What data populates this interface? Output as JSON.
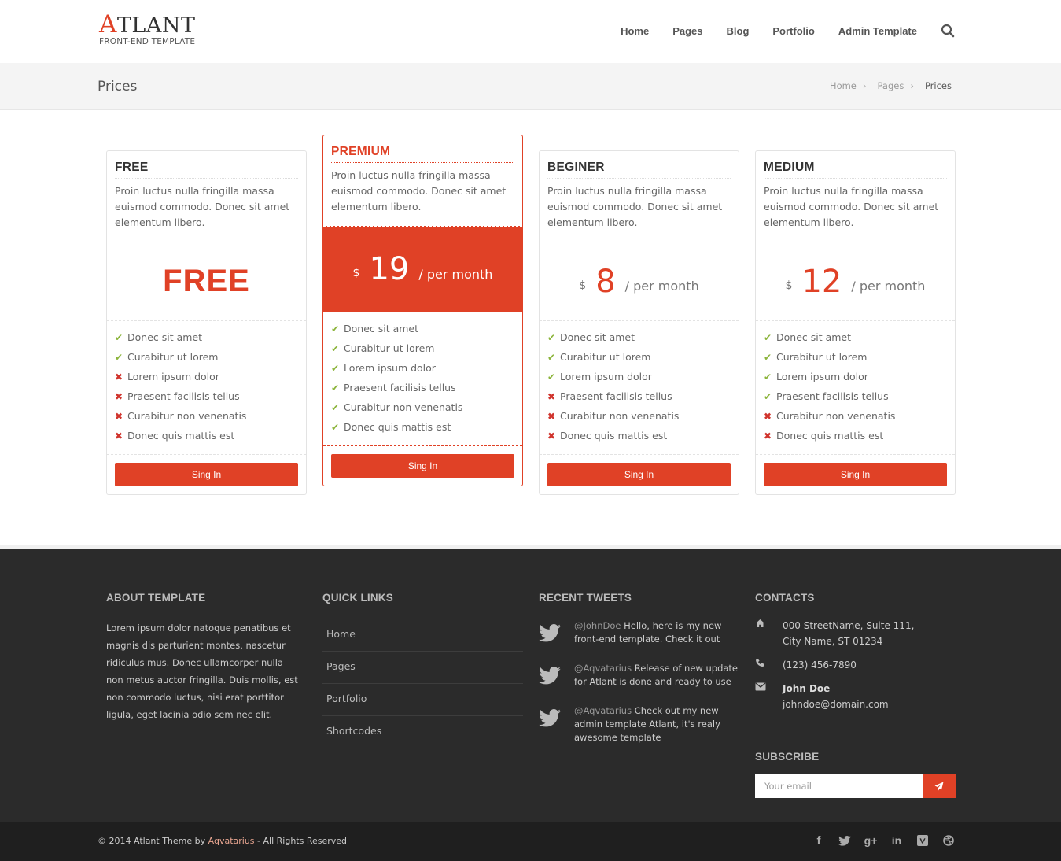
{
  "logo": {
    "first_letter": "A",
    "rest": "TLANT",
    "subtitle": "FRONT-END TEMPLATE"
  },
  "nav": {
    "items": [
      "Home",
      "Pages",
      "Blog",
      "Portfolio",
      "Admin Template"
    ],
    "search_icon": "search-icon"
  },
  "page": {
    "title": "Prices"
  },
  "breadcrumb": {
    "items": [
      "Home",
      "Pages",
      "Prices"
    ]
  },
  "colors": {
    "accent": "#e04126",
    "check": "#8bb43a",
    "cross": "#d0332c",
    "footer_bg": "#2b2b2b",
    "bottom_bg": "#1f1f1f"
  },
  "plans": [
    {
      "name": "FREE",
      "description": "Proin luctus nulla fringilla massa euismod commodo. Donec sit amet elementum libero.",
      "price_label": "FREE",
      "features": [
        {
          "text": "Donec sit amet",
          "included": true
        },
        {
          "text": "Curabitur ut lorem",
          "included": true
        },
        {
          "text": "Lorem ipsum dolor",
          "included": false
        },
        {
          "text": "Praesent facilisis tellus",
          "included": false
        },
        {
          "text": "Curabitur non venenatis",
          "included": false
        },
        {
          "text": "Donec quis mattis est",
          "included": false
        }
      ],
      "button": "Sing In"
    },
    {
      "name": "PREMIUM",
      "description": "Proin luctus nulla fringilla massa euismod commodo. Donec sit amet elementum libero.",
      "currency": "$",
      "amount": "19",
      "period": "/ per month",
      "features": [
        {
          "text": "Donec sit amet",
          "included": true
        },
        {
          "text": "Curabitur ut lorem",
          "included": true
        },
        {
          "text": "Lorem ipsum dolor",
          "included": true
        },
        {
          "text": "Praesent facilisis tellus",
          "included": true
        },
        {
          "text": "Curabitur non venenatis",
          "included": true
        },
        {
          "text": "Donec quis mattis est",
          "included": true
        }
      ],
      "button": "Sing In"
    },
    {
      "name": "BEGINER",
      "description": "Proin luctus nulla fringilla massa euismod commodo. Donec sit amet elementum libero.",
      "currency": "$",
      "amount": "8",
      "period": "/ per month",
      "features": [
        {
          "text": "Donec sit amet",
          "included": true
        },
        {
          "text": "Curabitur ut lorem",
          "included": true
        },
        {
          "text": "Lorem ipsum dolor",
          "included": true
        },
        {
          "text": "Praesent facilisis tellus",
          "included": false
        },
        {
          "text": "Curabitur non venenatis",
          "included": false
        },
        {
          "text": "Donec quis mattis est",
          "included": false
        }
      ],
      "button": "Sing In"
    },
    {
      "name": "MEDIUM",
      "description": "Proin luctus nulla fringilla massa euismod commodo. Donec sit amet elementum libero.",
      "currency": "$",
      "amount": "12",
      "period": "/ per month",
      "features": [
        {
          "text": "Donec sit amet",
          "included": true
        },
        {
          "text": "Curabitur ut lorem",
          "included": true
        },
        {
          "text": "Lorem ipsum dolor",
          "included": true
        },
        {
          "text": "Praesent facilisis tellus",
          "included": true
        },
        {
          "text": "Curabitur non venenatis",
          "included": false
        },
        {
          "text": "Donec quis mattis est",
          "included": false
        }
      ],
      "button": "Sing In"
    }
  ],
  "footer": {
    "about": {
      "title": "ABOUT TEMPLATE",
      "text": "Lorem ipsum dolor natoque penatibus et magnis dis parturient montes, nascetur ridiculus mus. Donec ullamcorper nulla non metus auctor fringilla. Duis mollis, est non commodo luctus, nisi erat porttitor ligula, eget lacinia odio sem nec elit."
    },
    "links": {
      "title": "QUICK LINKS",
      "items": [
        "Home",
        "Pages",
        "Portfolio",
        "Shortcodes"
      ]
    },
    "tweets": {
      "title": "RECENT TWEETS",
      "items": [
        {
          "user": "@JohnDoe",
          "text": " Hello, here is my new front-end template. Check it out"
        },
        {
          "user": "@Aqvatarius",
          "text": " Release of new update for Atlant is done and ready to use"
        },
        {
          "user": "@Aqvatarius",
          "text": " Check out my new admin template Atlant, it's realy awesome template"
        }
      ]
    },
    "contacts": {
      "title": "CONTACTS",
      "address_line1": "000 StreetName, Suite 111,",
      "address_line2": "City Name, ST 01234",
      "phone": "(123) 456-7890",
      "name": "John Doe",
      "email": "johndoe@domain.com"
    },
    "subscribe": {
      "title": "SUBSCRIBE",
      "placeholder": "Your email"
    }
  },
  "bottom": {
    "copyright_prefix": "© 2014 Atlant Theme by ",
    "copyright_author": "Aqvatarius",
    "copyright_suffix": " - All Rights Reserved",
    "socials": [
      "facebook-icon",
      "twitter-icon",
      "google-plus-icon",
      "linkedin-icon",
      "vimeo-icon",
      "dribbble-icon"
    ]
  }
}
